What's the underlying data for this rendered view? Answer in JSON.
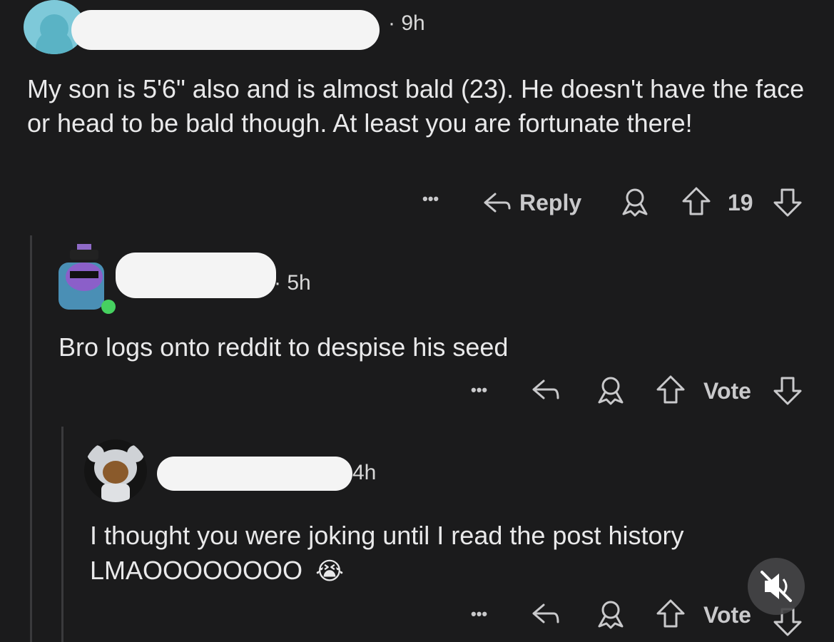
{
  "comments": [
    {
      "time": "· 9h",
      "body": "My son is 5'6\" also and is almost bald (23). He doesn't have the face or head to be bald though. At least you are fortunate there!",
      "more_label": "•••",
      "reply_label": "Reply",
      "vote_label": "19",
      "avatar_icon": "reddit-snoo-avatar"
    },
    {
      "time": "· 5h",
      "body": "Bro logs onto reddit to despise his seed",
      "more_label": "•••",
      "vote_label": "Vote",
      "avatar_icon": "purple-snoo-avatar"
    },
    {
      "time": "4h",
      "body_line1": "I thought you were joking until I read the post history",
      "body_line2": "LMAOOOOOOOO",
      "emoji": "😭",
      "more_label": "•••",
      "vote_label": "Vote",
      "avatar_icon": "koala-hoodie-avatar"
    }
  ],
  "colors": {
    "background": "#1b1b1c",
    "text": "#e9e9ea",
    "online_dot": "#46d160",
    "redaction": "#f4f4f4"
  },
  "overlay": {
    "mute_icon": "speaker-muted-icon"
  }
}
